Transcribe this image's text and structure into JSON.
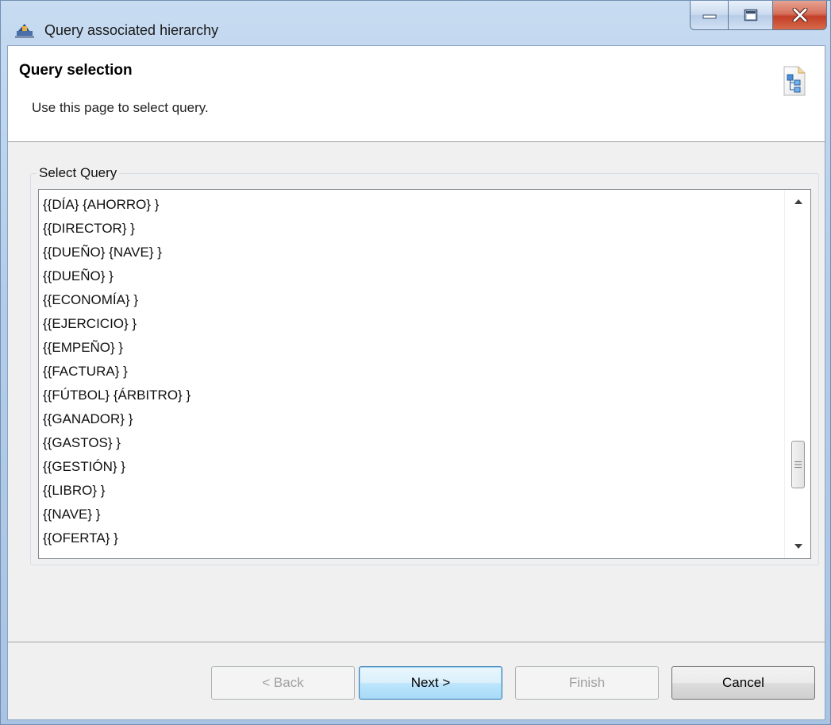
{
  "window": {
    "title": "Query associated hierarchy"
  },
  "header": {
    "title": "Query selection",
    "description": "Use this page to select query."
  },
  "group": {
    "label": "Select Query",
    "items": [
      "{{DÍA} {AHORRO} }",
      "{{DIRECTOR} }",
      "{{DUEÑO} {NAVE} }",
      "{{DUEÑO} }",
      "{{ECONOMÍA} }",
      "{{EJERCICIO} }",
      "{{EMPEÑO} }",
      "{{FACTURA} }",
      "{{FÚTBOL} {ÁRBITRO} }",
      "{{GANADOR} }",
      "{{GASTOS} }",
      "{{GESTIÓN} }",
      "{{LIBRO} }",
      "{{NAVE} }",
      "{{OFERTA} }"
    ]
  },
  "buttons": {
    "back": "< Back",
    "next": "Next >",
    "finish": "Finish",
    "cancel": "Cancel"
  },
  "icons": {
    "app": "window-app-icon",
    "wizard": "hierarchy-icon",
    "minimize": "minimize-icon",
    "maximize": "maximize-icon",
    "close": "close-icon"
  },
  "colors": {
    "close_button": "#c33f27",
    "default_button_border": "#3c7fb1",
    "dialog_background": "#f0f0f0"
  }
}
